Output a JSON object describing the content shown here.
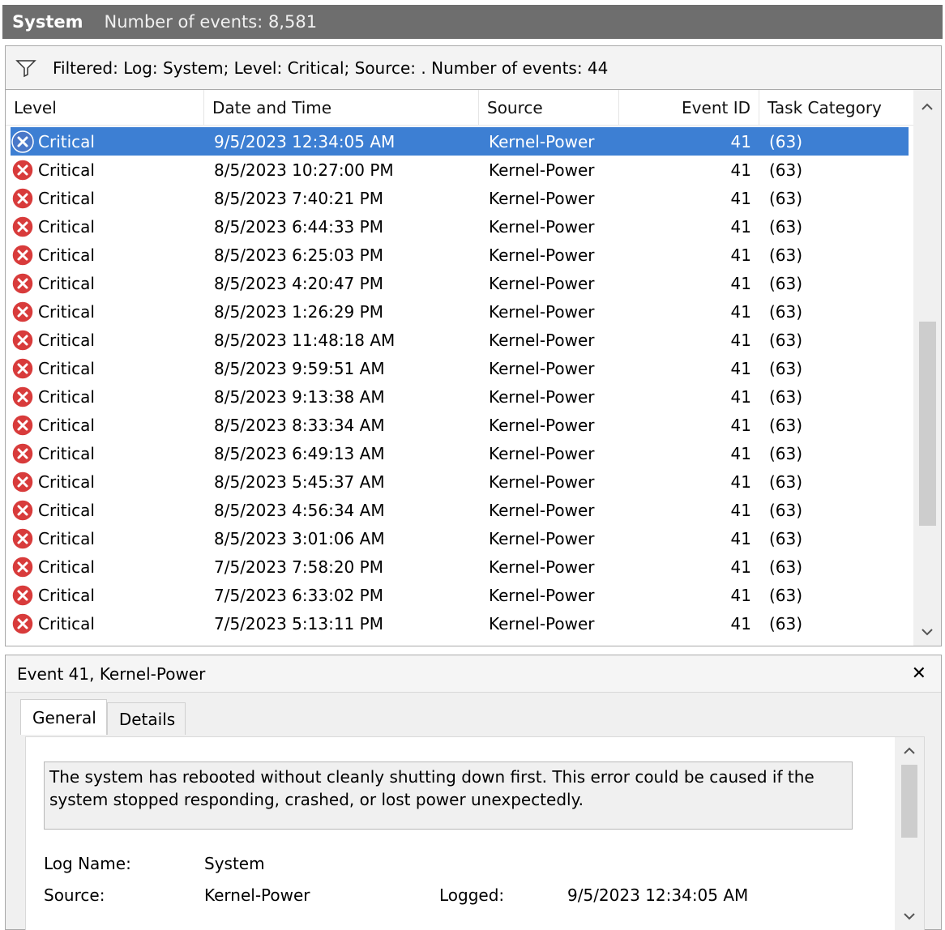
{
  "titlebar": {
    "log_name": "System",
    "event_count": "Number of events: 8,581"
  },
  "filter": {
    "icon": "funnel-icon",
    "text": "Filtered: Log: System; Level: Critical; Source: . Number of events: 44"
  },
  "columns": {
    "level": "Level",
    "date_time": "Date and Time",
    "source": "Source",
    "event_id": "Event ID",
    "task_category": "Task Category"
  },
  "colors": {
    "selected_row": "#3d7fd3",
    "critical_icon": "#d83b3b",
    "selected_icon": "#4a78c8",
    "titlebar": "#6e6e6e"
  },
  "rows": [
    {
      "level": "Critical",
      "date": "9/5/2023 12:34:05 AM",
      "source": "Kernel-Power",
      "event_id": "41",
      "task": "(63)",
      "selected": true
    },
    {
      "level": "Critical",
      "date": "8/5/2023 10:27:00 PM",
      "source": "Kernel-Power",
      "event_id": "41",
      "task": "(63)"
    },
    {
      "level": "Critical",
      "date": "8/5/2023 7:40:21 PM",
      "source": "Kernel-Power",
      "event_id": "41",
      "task": "(63)"
    },
    {
      "level": "Critical",
      "date": "8/5/2023 6:44:33 PM",
      "source": "Kernel-Power",
      "event_id": "41",
      "task": "(63)"
    },
    {
      "level": "Critical",
      "date": "8/5/2023 6:25:03 PM",
      "source": "Kernel-Power",
      "event_id": "41",
      "task": "(63)"
    },
    {
      "level": "Critical",
      "date": "8/5/2023 4:20:47 PM",
      "source": "Kernel-Power",
      "event_id": "41",
      "task": "(63)"
    },
    {
      "level": "Critical",
      "date": "8/5/2023 1:26:29 PM",
      "source": "Kernel-Power",
      "event_id": "41",
      "task": "(63)"
    },
    {
      "level": "Critical",
      "date": "8/5/2023 11:48:18 AM",
      "source": "Kernel-Power",
      "event_id": "41",
      "task": "(63)"
    },
    {
      "level": "Critical",
      "date": "8/5/2023 9:59:51 AM",
      "source": "Kernel-Power",
      "event_id": "41",
      "task": "(63)"
    },
    {
      "level": "Critical",
      "date": "8/5/2023 9:13:38 AM",
      "source": "Kernel-Power",
      "event_id": "41",
      "task": "(63)"
    },
    {
      "level": "Critical",
      "date": "8/5/2023 8:33:34 AM",
      "source": "Kernel-Power",
      "event_id": "41",
      "task": "(63)"
    },
    {
      "level": "Critical",
      "date": "8/5/2023 6:49:13 AM",
      "source": "Kernel-Power",
      "event_id": "41",
      "task": "(63)"
    },
    {
      "level": "Critical",
      "date": "8/5/2023 5:45:37 AM",
      "source": "Kernel-Power",
      "event_id": "41",
      "task": "(63)"
    },
    {
      "level": "Critical",
      "date": "8/5/2023 4:56:34 AM",
      "source": "Kernel-Power",
      "event_id": "41",
      "task": "(63)"
    },
    {
      "level": "Critical",
      "date": "8/5/2023 3:01:06 AM",
      "source": "Kernel-Power",
      "event_id": "41",
      "task": "(63)"
    },
    {
      "level": "Critical",
      "date": "7/5/2023 7:58:20 PM",
      "source": "Kernel-Power",
      "event_id": "41",
      "task": "(63)"
    },
    {
      "level": "Critical",
      "date": "7/5/2023 6:33:02 PM",
      "source": "Kernel-Power",
      "event_id": "41",
      "task": "(63)"
    },
    {
      "level": "Critical",
      "date": "7/5/2023 5:13:11 PM",
      "source": "Kernel-Power",
      "event_id": "41",
      "task": "(63)"
    }
  ],
  "detail": {
    "title": "Event 41, Kernel-Power",
    "close": "✕",
    "tabs": [
      "General",
      "Details"
    ],
    "description": "The system has rebooted without cleanly shutting down first. This error could be caused if the system stopped responding, crashed, or lost power unexpectedly.",
    "log_name_label": "Log Name:",
    "log_name_value": "System",
    "source_label": "Source:",
    "source_value": "Kernel-Power",
    "logged_label": "Logged:",
    "logged_value": "9/5/2023 12:34:05 AM"
  }
}
